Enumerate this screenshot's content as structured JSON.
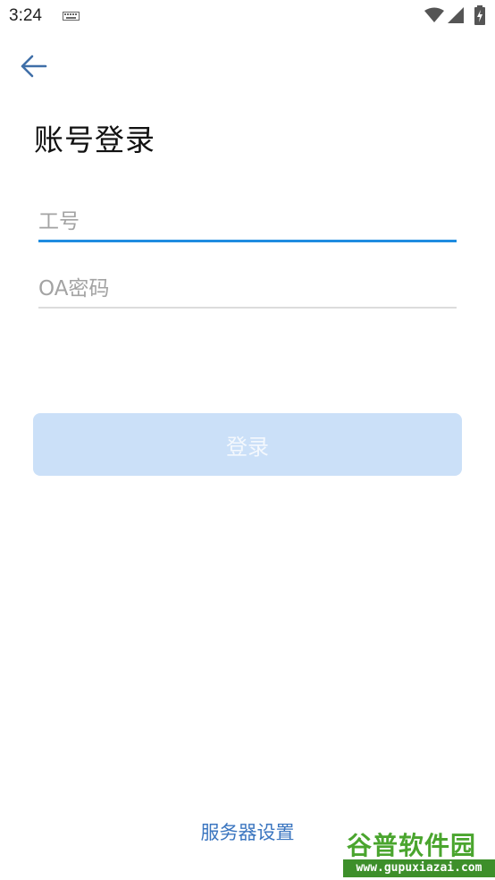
{
  "status_bar": {
    "time": "3:24",
    "icons": [
      "keyboard-icon",
      "wifi-icon",
      "signal-icon",
      "battery-charging-icon"
    ]
  },
  "nav": {
    "back_icon": "arrow-left-icon"
  },
  "page": {
    "title": "账号登录"
  },
  "form": {
    "employee_id": {
      "placeholder": "工号",
      "value": ""
    },
    "password": {
      "placeholder": "OA密码",
      "value": ""
    },
    "login_label": "登录"
  },
  "footer": {
    "server_settings_label": "服务器设置"
  },
  "watermark": {
    "title": "谷普软件园",
    "url": "www.gupuxiazai.com"
  },
  "colors": {
    "accent": "#1f8ce0",
    "button_disabled_bg": "#cbe0f8",
    "link": "#3b76c0",
    "back_arrow": "#3f6fa8"
  }
}
